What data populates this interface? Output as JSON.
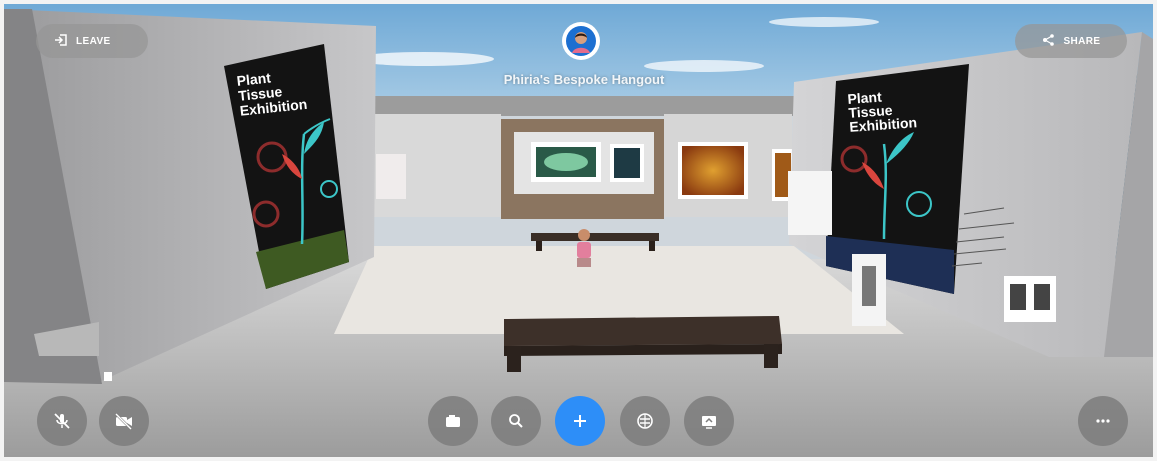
{
  "topbar": {
    "leave_label": "LEAVE",
    "share_label": "SHARE",
    "room_title": "Phiria's Bespoke Hangout"
  },
  "scene": {
    "poster_left": {
      "lines": [
        "Plant",
        "Tissue",
        "Exhibition"
      ]
    },
    "poster_right": {
      "lines": [
        "Plant",
        "Tissue",
        "Exhibition"
      ]
    }
  },
  "controls": {
    "left": [
      "mic-off-icon",
      "camera-off-icon"
    ],
    "center": [
      "camera-icon",
      "search-icon",
      "add-icon",
      "emoji-icon",
      "screen-share-icon"
    ],
    "right": [
      "more-icon"
    ]
  },
  "colors": {
    "accent": "#2d8ef8",
    "control_bg": "#7d7d7d",
    "poster_bg": "#111111",
    "leaf": "#3cc6c8"
  }
}
